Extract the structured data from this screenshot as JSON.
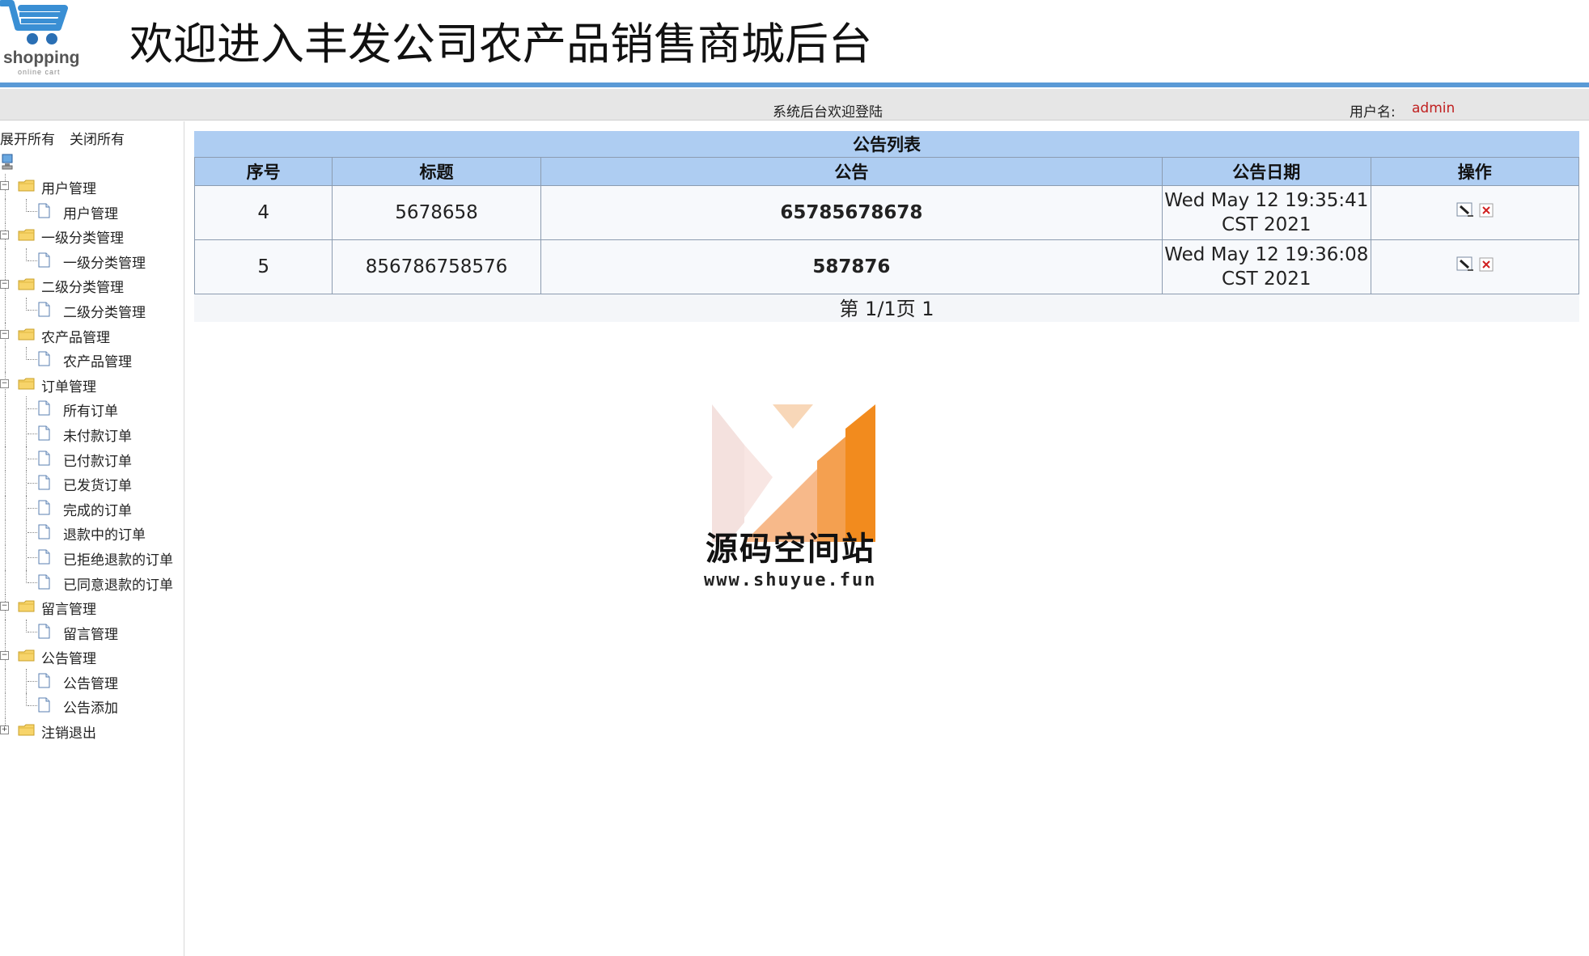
{
  "header": {
    "logo_text": "shopping",
    "logo_sub": "online cart",
    "title": "欢迎进入丰发公司农产品销售商城后台"
  },
  "statusbar": {
    "welcome": "系统后台欢迎登陆",
    "user_label": "用户名:",
    "user_name": "admin"
  },
  "sidebar": {
    "expand_all": "展开所有",
    "collapse_all": "关闭所有",
    "groups": [
      {
        "label": "用户管理",
        "items": [
          "用户管理"
        ]
      },
      {
        "label": "一级分类管理",
        "items": [
          "一级分类管理"
        ]
      },
      {
        "label": "二级分类管理",
        "items": [
          "二级分类管理"
        ]
      },
      {
        "label": "农产品管理",
        "items": [
          "农产品管理"
        ]
      },
      {
        "label": "订单管理",
        "items": [
          "所有订单",
          "未付款订单",
          "已付款订单",
          "已发货订单",
          "完成的订单",
          "退款中的订单",
          "已拒绝退款的订单",
          "已同意退款的订单"
        ]
      },
      {
        "label": "留言管理",
        "items": [
          "留言管理"
        ]
      },
      {
        "label": "公告管理",
        "items": [
          "公告管理",
          "公告添加"
        ]
      },
      {
        "label": "注销退出",
        "items": []
      }
    ]
  },
  "main": {
    "list_title": "公告列表",
    "columns": [
      "序号",
      "标题",
      "公告",
      "公告日期",
      "操作"
    ],
    "rows": [
      {
        "id": "4",
        "title": "5678658",
        "notice": "65785678678",
        "date_line1": "Wed May 12 19:35:41",
        "date_line2": "CST 2021"
      },
      {
        "id": "5",
        "title": "856786758576",
        "notice": "587876",
        "date_line1": "Wed May 12 19:36:08",
        "date_line2": "CST 2021"
      }
    ],
    "pager": "第 1/1页 1"
  },
  "watermark": {
    "title": "源码空间站",
    "url": "www.shuyue.fun"
  },
  "colors": {
    "accent_blue": "#5a9ad6",
    "table_header": "#aecdf2",
    "notice_red": "#c0202a",
    "username_red": "#c02020"
  }
}
